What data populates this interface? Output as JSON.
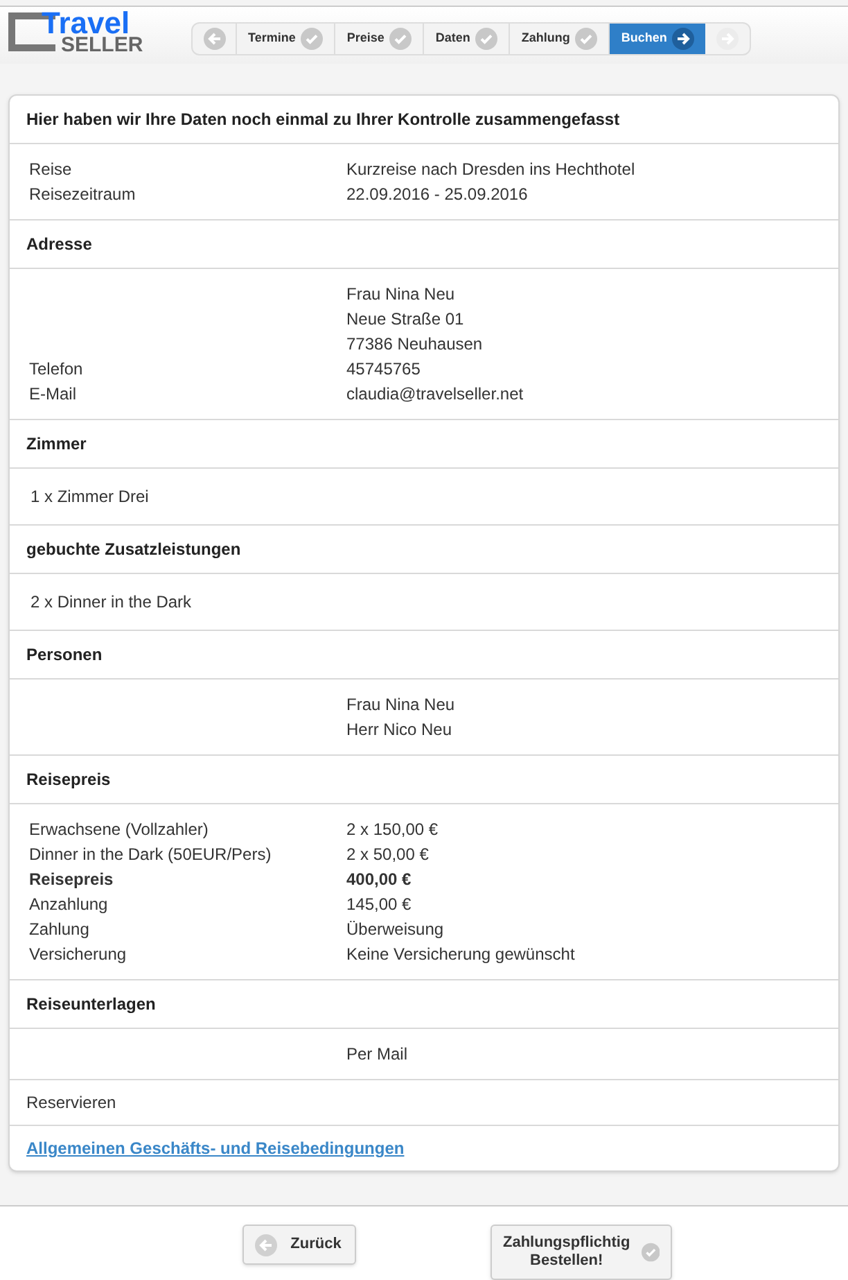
{
  "logo": {
    "top": "Travel",
    "bottom": "SELLER"
  },
  "steps": [
    {
      "label": "Termine",
      "done": true,
      "selected": false
    },
    {
      "label": "Preise",
      "done": true,
      "selected": false
    },
    {
      "label": "Daten",
      "done": true,
      "selected": false
    },
    {
      "label": "Zahlung",
      "done": true,
      "selected": false
    },
    {
      "label": "Buchen",
      "done": false,
      "selected": true
    }
  ],
  "card_title": "Hier haben wir Ihre Daten noch einmal zu Ihrer Kontrolle zusammengefasst",
  "sections": [
    {
      "kind": "pairs",
      "rows": [
        {
          "label": "Reise",
          "value": "Kurzreise nach Dresden ins Hechthotel"
        },
        {
          "label": "Reisezeitraum",
          "value": "22.09.2016  - 25.09.2016"
        }
      ]
    },
    {
      "kind": "heading",
      "text": "Adresse"
    },
    {
      "kind": "pairs",
      "rows": [
        {
          "value": "Frau Nina Neu"
        },
        {
          "value": "Neue Straße 01"
        },
        {
          "value": "77386 Neuhausen"
        },
        {
          "label": "Telefon",
          "value": "45745765"
        },
        {
          "label": "E-Mail",
          "value": "claudia@travelseller.net"
        }
      ]
    },
    {
      "kind": "heading",
      "text": "Zimmer"
    },
    {
      "kind": "text",
      "text": "1 x Zimmer Drei"
    },
    {
      "kind": "heading",
      "text": "gebuchte Zusatzleistungen"
    },
    {
      "kind": "text",
      "text": "2 x  Dinner in the Dark"
    },
    {
      "kind": "heading",
      "text": "Personen"
    },
    {
      "kind": "pairs",
      "rows": [
        {
          "value": "Frau Nina Neu"
        },
        {
          "value": "Herr Nico Neu"
        }
      ]
    },
    {
      "kind": "heading",
      "text": "Reisepreis"
    },
    {
      "kind": "pairs",
      "rows": [
        {
          "label": "Erwachsene (Vollzahler)",
          "value": "2 x 150,00 €",
          "bold": false
        },
        {
          "label": "Dinner in the Dark (50EUR/Pers)",
          "value": "2 x 50,00 €",
          "bold": false
        },
        {
          "label": "Reisepreis",
          "value": "400,00 €",
          "bold": true
        },
        {
          "label": "Anzahlung",
          "value": "145,00 €",
          "bold": false
        },
        {
          "label": "Zahlung",
          "value": "Überweisung",
          "bold": false
        },
        {
          "label": "Versicherung",
          "value": "Keine Versicherung gewünscht",
          "bold": false
        }
      ]
    },
    {
      "kind": "heading",
      "text": "Reiseunterlagen"
    },
    {
      "kind": "pairs",
      "rows": [
        {
          "value": "Per Mail"
        }
      ]
    },
    {
      "kind": "plain",
      "text": "Reservieren"
    },
    {
      "kind": "link",
      "text": "Allgemeinen Geschäfts- und Reisebedingungen"
    }
  ],
  "buttons": [
    {
      "kind": "back",
      "label": "Zurück"
    },
    {
      "kind": "order",
      "label": "Zahlungspflichtig Bestellen!"
    }
  ]
}
